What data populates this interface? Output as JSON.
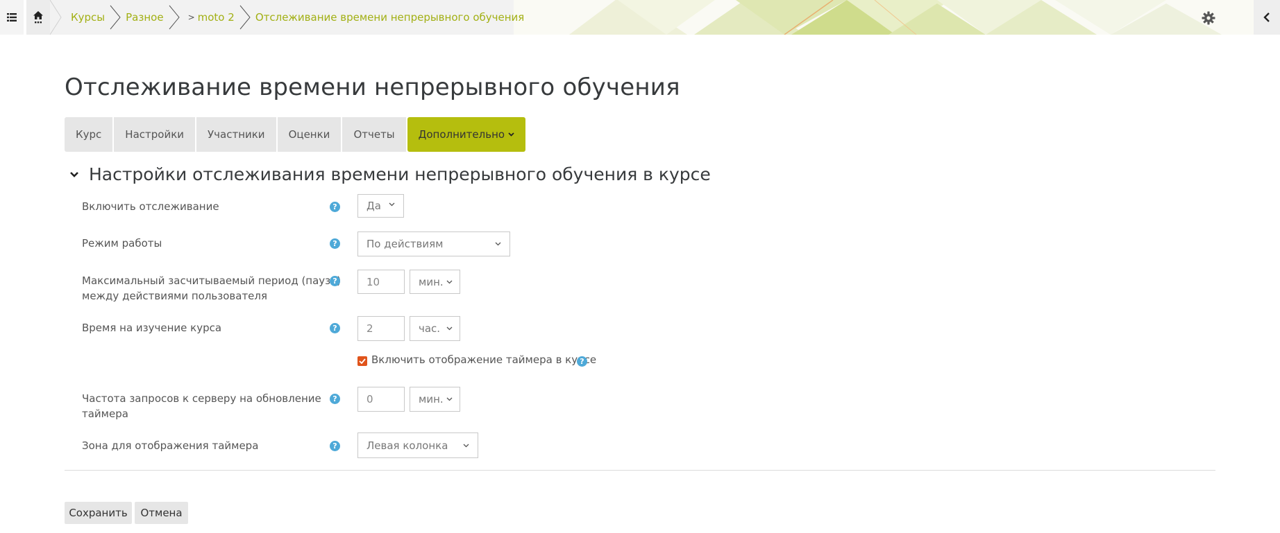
{
  "breadcrumb": {
    "items": [
      "Курсы",
      "Разное",
      "moto 2",
      "Отслеживание времени непрерывного обучения"
    ]
  },
  "icons": {
    "menu": "list-icon",
    "home": "home-icon",
    "settings": "gear-icon",
    "drawer": "chevron-left-icon",
    "module": "table-icon"
  },
  "page": {
    "title": "Отслеживание времени непрерывного обучения"
  },
  "tabs": [
    {
      "label": "Курс"
    },
    {
      "label": "Настройки"
    },
    {
      "label": "Участники"
    },
    {
      "label": "Оценки"
    },
    {
      "label": "Отчеты"
    },
    {
      "label": "Дополнительно",
      "active": true
    }
  ],
  "section": {
    "title": "Настройки отслеживания времени непрерывного обучения в курсе"
  },
  "form": {
    "enable_tracking": {
      "label": "Включить отслеживание",
      "value": "Да"
    },
    "mode": {
      "label": "Режим работы",
      "value": "По действиям"
    },
    "max_pause": {
      "label_line1": "Максимальный засчитываемый период (пауза)",
      "label_line2": "между действиями пользователя",
      "value": "10",
      "unit": "мин."
    },
    "course_time": {
      "label": "Время на изучение курса",
      "value": "2",
      "unit": "час."
    },
    "show_timer": {
      "label": "Включить отображение таймера в курсе",
      "checked": true
    },
    "refresh_rate": {
      "label_line1": "Частота запросов к серверу на обновление",
      "label_line2": "таймера",
      "value": "0",
      "unit": "мин."
    },
    "timer_zone": {
      "label": "Зона для отображения таймера",
      "value": "Левая колонка"
    }
  },
  "buttons": {
    "save": "Сохранить",
    "cancel": "Отмена"
  },
  "colors": {
    "accent": "#b5be0e",
    "link": "#a2b014",
    "help": "#4ea9d8",
    "checkbox": "#e0541b"
  }
}
